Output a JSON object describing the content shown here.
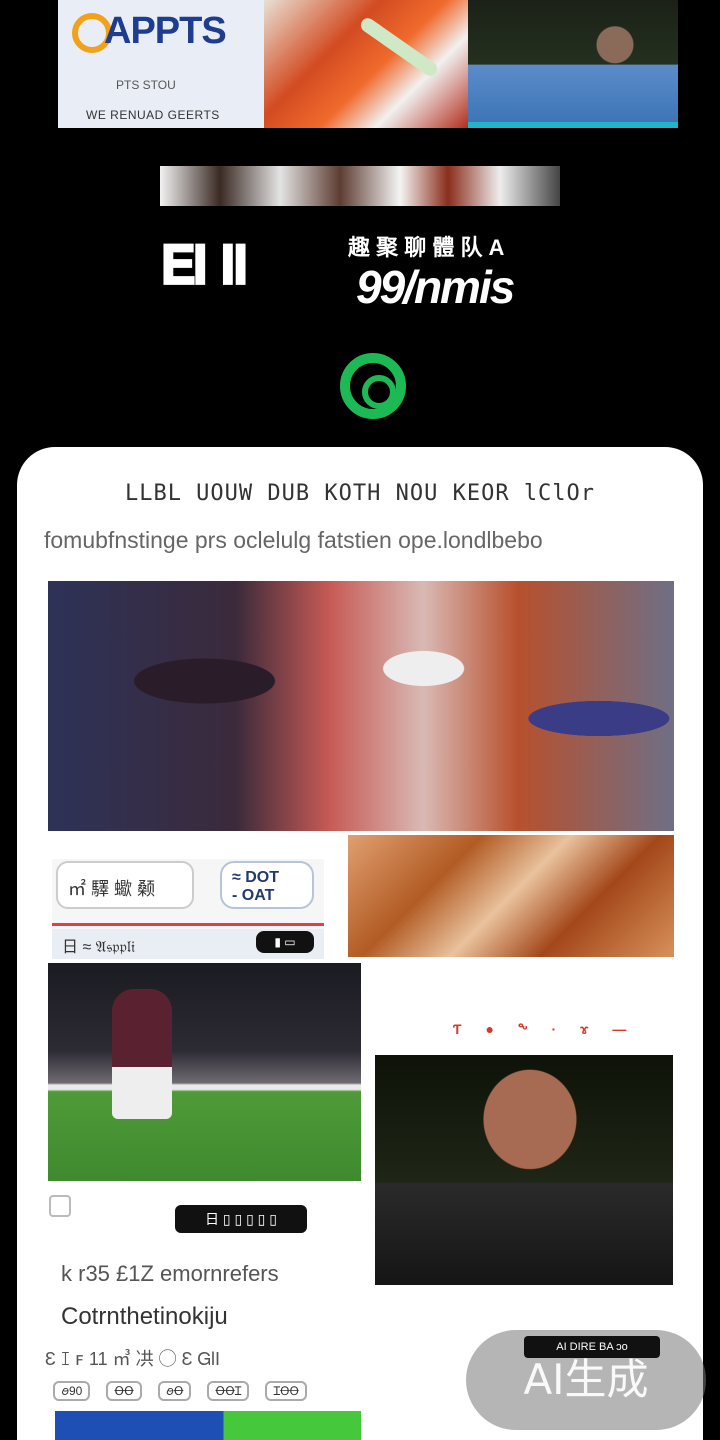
{
  "top_strip": {
    "logo_text": "APPTS",
    "logo_sub": "PTS STOU",
    "logo_tag": "WE RENUAD GEERTS"
  },
  "glitch_title": {
    "left_text": "𝐄𝐈 𝐈𝐈",
    "right_top": "趣 聚 聊 體 队 A",
    "right_bottom": "99/nmis"
  },
  "card": {
    "heading": "LLBL   UOUW    DUB  KOTH NOU  KEOR lClOr",
    "subheading": "fomubfnstinge prs oclelulg fatstien ope.londlbebo"
  },
  "promo": {
    "chip_a": "㎡ 驛 蠍 颡",
    "chip_b_line1": "≈ DOT",
    "chip_b_line2": "- OAT",
    "bar_text": "日   ≈ 𝔄𝔰𝔭𝔭𝔩𝔦",
    "pill": "▮ ▭"
  },
  "red_dots": "Ƭ ● ᖕ · ɤ —",
  "caption_pill": "日 ▯ ▯ ▯ ▯ ▯",
  "list": {
    "line1": "k  r35   £1Z   emornrefers",
    "line2": "Cotrnthetinokiju",
    "line3": "Ɛ  ꕯ  ꜰ   11    ㎥ 㓋 ◯ Ɛ   ᏀlI"
  },
  "chips": [
    "ꪮ90",
    "ꝊꝊ",
    "ꪮꝊ",
    "ꝊꝊꞮ",
    "ꞮꝊꝊ"
  ],
  "ai_badge": {
    "label": "AI生成",
    "pill": "AI DIRE BA ɔᴏ"
  }
}
